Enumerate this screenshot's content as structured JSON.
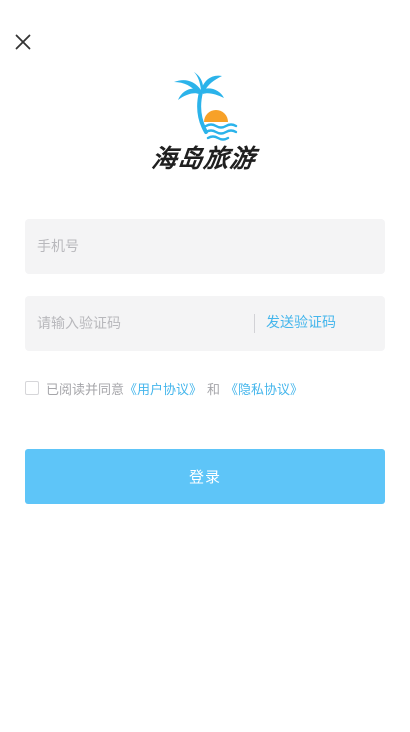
{
  "header": {
    "close_icon": "close-icon"
  },
  "logo": {
    "icon": "palm-tree-sunset-icon",
    "text": "海岛旅游",
    "colors": {
      "palm": "#2bb3ea",
      "sun": "#f7a128",
      "waves": "#2bb3ea"
    }
  },
  "form": {
    "phone_placeholder": "手机号",
    "phone_value": "",
    "code_placeholder": "请输入验证码",
    "code_value": "",
    "send_code_label": "发送验证码"
  },
  "agreement": {
    "checked": false,
    "prefix": "已阅读并同意",
    "user_agreement": "《用户协议》",
    "and": "和",
    "privacy_agreement": "《隐私协议》"
  },
  "login": {
    "label": "登录"
  },
  "colors": {
    "accent": "#45b6ec",
    "button": "#5ec5f8",
    "field_bg": "#f4f4f5"
  }
}
